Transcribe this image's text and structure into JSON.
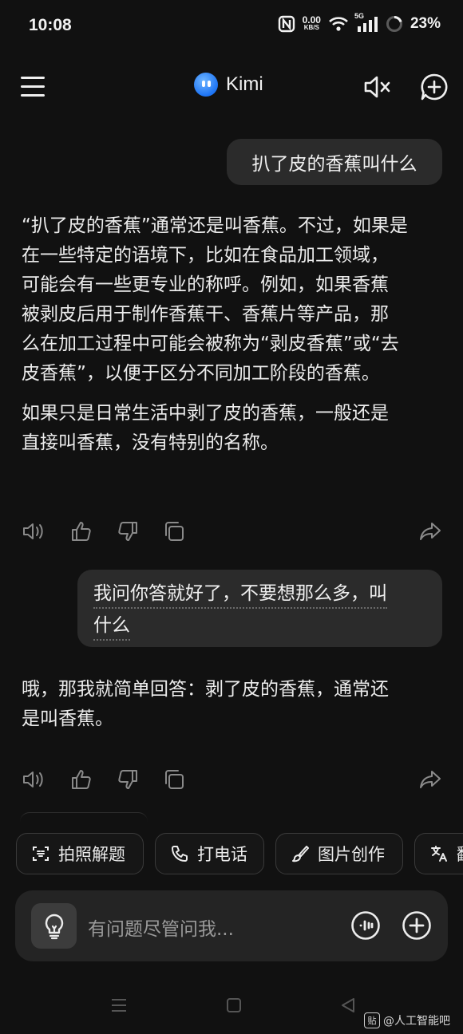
{
  "status_bar": {
    "time": "10:08",
    "net_speed_value": "0.00",
    "net_speed_unit": "KB/S",
    "network_type": "5G",
    "battery": "23%"
  },
  "header": {
    "app_name": "Kimi"
  },
  "conversation": {
    "user_message_1": "扒了皮的香蕉叫什么",
    "ai_reply_1": {
      "lines": [
        "“扒了皮的香蕉”通常还是叫香蕉。不过，如果是",
        "在一些特定的语境下，比如在食品加工领域，",
        "可能会有一些更专业的称呼。例如，如果香蕉",
        "被剥皮后用于制作香蕉干、香蕉片等产品，那",
        "么在加工过程中可能会被称为“剥皮香蕉”或“去",
        "皮香蕉”，以便于区分不同加工阶段的香蕉。"
      ],
      "lines_p2": [
        "如果只是日常生活中剥了皮的香蕉，一般还是",
        "直接叫香蕉，没有特别的名称。"
      ]
    },
    "user_message_2": {
      "line1": "我问你答就好了，不要想那么多，叫",
      "line2": "什么"
    },
    "ai_reply_2": {
      "lines": [
        "哦，那我就简单回答：剥了皮的香蕉，通常还",
        "是叫香蕉。"
      ]
    }
  },
  "suggestion_chips": [
    {
      "label": "拍照解题",
      "icon": "scan-icon"
    },
    {
      "label": "打电话",
      "icon": "phone-icon"
    },
    {
      "label": "图片创作",
      "icon": "brush-icon"
    },
    {
      "label": "翻",
      "icon": "translate-icon"
    }
  ],
  "input": {
    "placeholder": "有问题尽管问我..."
  },
  "watermark": {
    "badge": "贴",
    "text": "@人工智能吧"
  },
  "colors": {
    "background": "#111111",
    "bubble": "#2b2b2b",
    "input_bg": "#242424",
    "accent_logo": "#1d74f5"
  }
}
